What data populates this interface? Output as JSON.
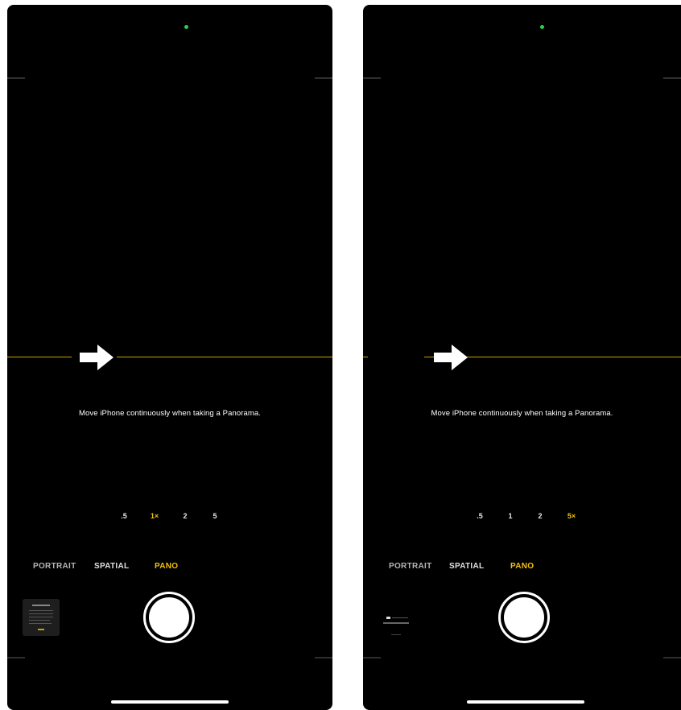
{
  "screens": [
    {
      "hint": "Move iPhone continuously when taking a Panorama.",
      "zoom_options": [
        ".5",
        "1×",
        "2",
        "5"
      ],
      "zoom_selected": "1×",
      "modes": [
        "PORTRAIT",
        "SPATIAL",
        "PANO"
      ],
      "mode_selected": "PANO",
      "icons": {
        "direction_arrow": "arrow-right-icon",
        "shutter": "shutter-button",
        "recording_indicator": "green-dot"
      }
    },
    {
      "hint": "Move iPhone continuously when taking a Panorama.",
      "zoom_options": [
        ".5",
        "1",
        "2",
        "5×"
      ],
      "zoom_selected": "5×",
      "modes": [
        "PORTRAIT",
        "SPATIAL",
        "PANO"
      ],
      "mode_selected": "PANO",
      "icons": {
        "direction_arrow": "arrow-right-icon",
        "shutter": "shutter-button",
        "recording_indicator": "green-dot"
      }
    }
  ],
  "colors": {
    "accent_yellow": "#f2c20a",
    "guide_line": "#c9a10a",
    "indicator_green": "#27d14b",
    "background": "#000000"
  }
}
